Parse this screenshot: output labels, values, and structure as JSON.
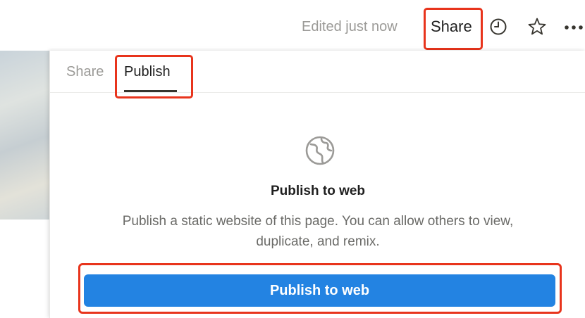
{
  "header": {
    "edited_status": "Edited just now",
    "share_label": "Share",
    "icons": [
      "clock-icon",
      "star-icon",
      "more-icon"
    ]
  },
  "popover": {
    "tabs": [
      {
        "label": "Share",
        "active": false
      },
      {
        "label": "Publish",
        "active": true
      }
    ],
    "icon": "globe-icon",
    "title": "Publish to web",
    "description": "Publish a static website of this page. You can allow others to view, duplicate, and remix.",
    "button_label": "Publish to web"
  },
  "colors": {
    "accent": "#2383e2",
    "highlight": "#e8341c",
    "muted_text": "#9b9a97"
  }
}
